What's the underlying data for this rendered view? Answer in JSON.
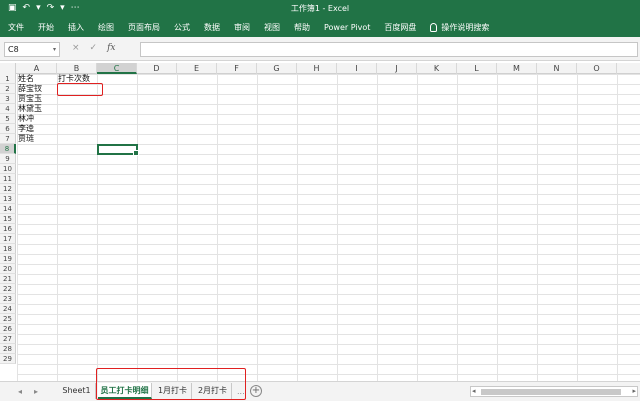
{
  "window": {
    "title": "工作簿1 - Excel"
  },
  "qat": {
    "save_icon": "▣",
    "undo_icon": "↶",
    "undo_drop": "▾",
    "redo_icon": "↷",
    "redo_drop": "▾",
    "more_icon": "⋯"
  },
  "ribbon": {
    "tabs": [
      "文件",
      "开始",
      "插入",
      "绘图",
      "页面布局",
      "公式",
      "数据",
      "审阅",
      "视图",
      "帮助",
      "Power Pivot",
      "百度网盘"
    ],
    "tell_me": "操作说明搜索"
  },
  "formula_bar": {
    "name_box": "C8",
    "name_arrow": "▾",
    "cancel": "×",
    "enter": "✓",
    "fx": "fx",
    "value": ""
  },
  "columns": [
    "A",
    "B",
    "C",
    "D",
    "E",
    "F",
    "G",
    "H",
    "I",
    "J",
    "K",
    "L",
    "M",
    "N",
    "O"
  ],
  "active_column": "C",
  "rows": [
    "1",
    "2",
    "3",
    "4",
    "5",
    "6",
    "7",
    "8",
    "9",
    "10",
    "11",
    "12",
    "13",
    "14",
    "15",
    "16",
    "17",
    "18",
    "19",
    "20",
    "21",
    "22",
    "23",
    "24",
    "25",
    "26",
    "27",
    "28",
    "29"
  ],
  "active_row": "8",
  "cells": {
    "A1": "姓名",
    "B1": "打卡次数",
    "A2": "薛宝钗",
    "A3": "贾宝玉",
    "A4": "林黛玉",
    "A5": "林冲",
    "A6": "李逵",
    "A7": "贾琏"
  },
  "sheets": {
    "tabs": [
      "Sheet1",
      "员工打卡明细",
      "1月打卡",
      "2月打卡"
    ],
    "active": "员工打卡明细",
    "nav_prev": "◂",
    "nav_next": "▸",
    "more": "...",
    "add": "+"
  },
  "colors": {
    "accent": "#217346",
    "annotation": "#e02020"
  }
}
